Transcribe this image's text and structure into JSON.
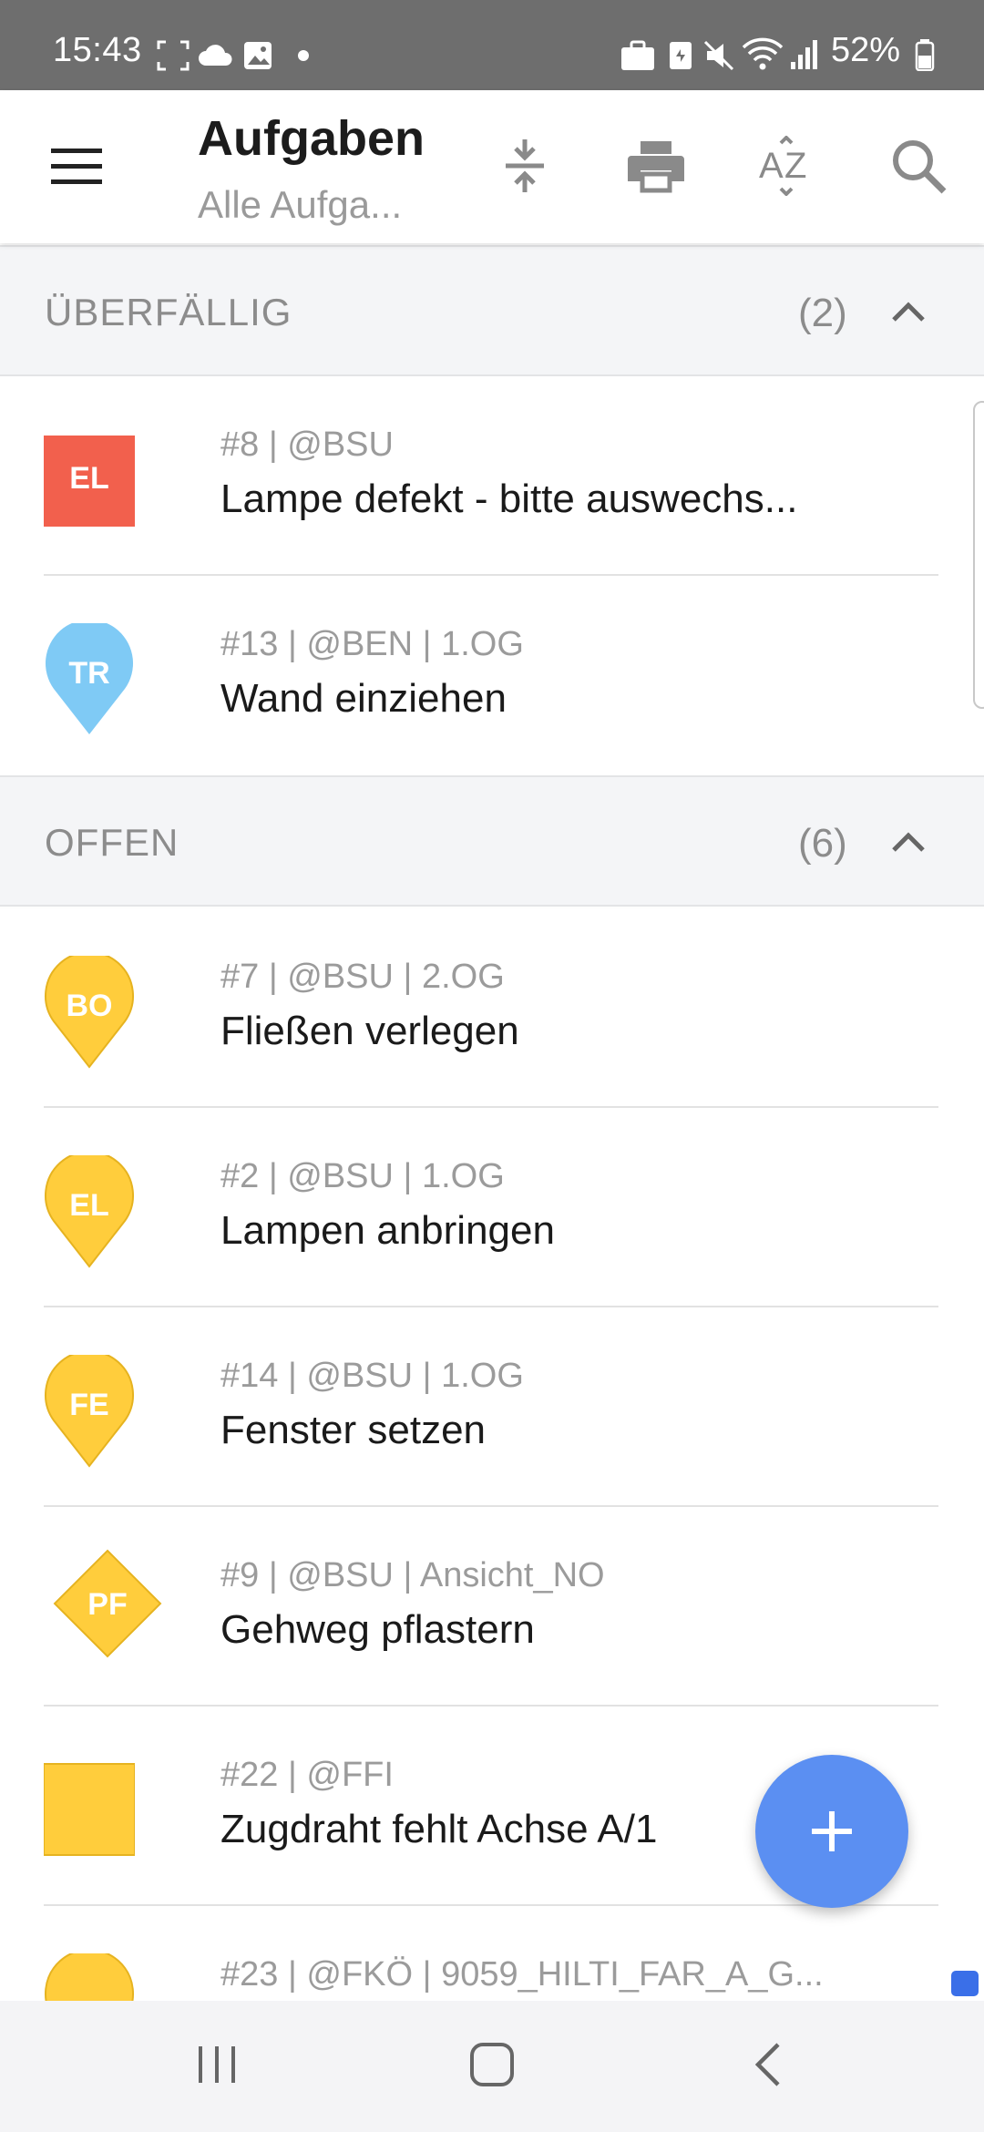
{
  "status_bar": {
    "time": "15:43",
    "battery": "52%",
    "left_icons": [
      "screenshot-icon",
      "cloud-icon",
      "gallery-icon",
      "dot-icon"
    ],
    "right_icons": [
      "briefcase-icon",
      "vpn-icon",
      "mute-icon",
      "wifi-icon",
      "signal-icon",
      "battery-icon"
    ]
  },
  "appbar": {
    "title": "Aufgaben",
    "subtitle": "Alle Aufga...",
    "actions": [
      "collapse-icon",
      "print-icon",
      "sort-az-icon",
      "search-icon"
    ]
  },
  "sections": [
    {
      "label": "ÜBERFÄLLIG",
      "count": "(2)",
      "tasks": [
        {
          "meta": "#8 | @BSU",
          "title": "Lampe defekt - bitte auswechs...",
          "badge": "EL",
          "shape": "square",
          "color": "#f2604d"
        },
        {
          "meta": "#13 | @BEN | 1.OG",
          "title": "Wand einziehen",
          "badge": "TR",
          "shape": "pin",
          "color": "#7fcaf5"
        }
      ]
    },
    {
      "label": "OFFEN",
      "count": "(6)",
      "tasks": [
        {
          "meta": "#7 | @BSU | 2.OG",
          "title": "Fließen verlegen",
          "badge": "BO",
          "shape": "pin",
          "color": "#ffcd3c"
        },
        {
          "meta": "#2 | @BSU | 1.OG",
          "title": "Lampen anbringen",
          "badge": "EL",
          "shape": "pin",
          "color": "#ffcd3c"
        },
        {
          "meta": "#14 | @BSU | 1.OG",
          "title": "Fenster setzen",
          "badge": "FE",
          "shape": "pin",
          "color": "#ffcd3c"
        },
        {
          "meta": "#9 | @BSU | Ansicht_NO",
          "title": "Gehweg pflastern",
          "badge": "PF",
          "shape": "diamond",
          "color": "#ffcd3c"
        },
        {
          "meta": "#22 | @FFI",
          "title": "Zugdraht fehlt Achse A/1",
          "badge": "",
          "shape": "square",
          "color": "#ffcd3c"
        },
        {
          "meta": "#23 | @FKÖ | 9059_HILTI_FAR_A_G...",
          "title": "",
          "badge": "",
          "shape": "pin",
          "color": "#ffcd3c"
        }
      ]
    }
  ],
  "fab": {
    "icon": "plus-icon"
  },
  "nav_bar": {
    "buttons": [
      "recent-apps-icon",
      "home-icon",
      "back-icon"
    ]
  }
}
